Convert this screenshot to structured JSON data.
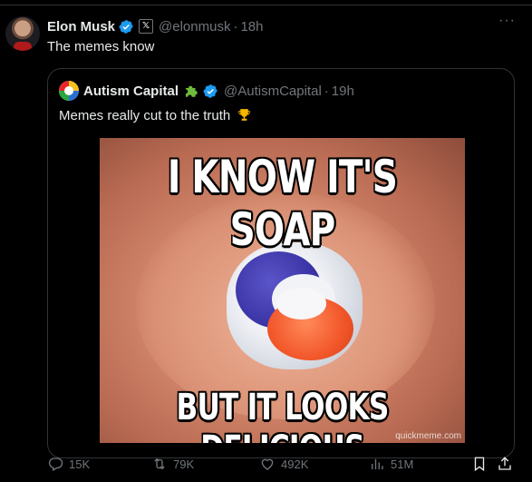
{
  "tweet": {
    "author_name": "Elon Musk",
    "handle": "@elonmusk",
    "separator": "·",
    "time": "18h",
    "x_badge": "𝕏",
    "text": "The memes know",
    "more_label": "···"
  },
  "quoted_tweet": {
    "author_name": "Autism Capital",
    "handle": "@AutismCapital",
    "separator": "·",
    "time": "19h",
    "text": "Memes really cut to the truth",
    "image": {
      "top_text": "I KNOW IT'S SOAP",
      "bottom_text": "BUT IT LOOKS DELICIOUS",
      "watermark": "quickmeme.com"
    }
  },
  "actions": {
    "replies": "15K",
    "reposts": "79K",
    "likes": "492K",
    "views": "51M"
  },
  "colors": {
    "background": "#000000",
    "text": "#e7e9ea",
    "secondary": "#71767b",
    "verified_blue": "#1d9bf0",
    "border": "#2f3336"
  }
}
